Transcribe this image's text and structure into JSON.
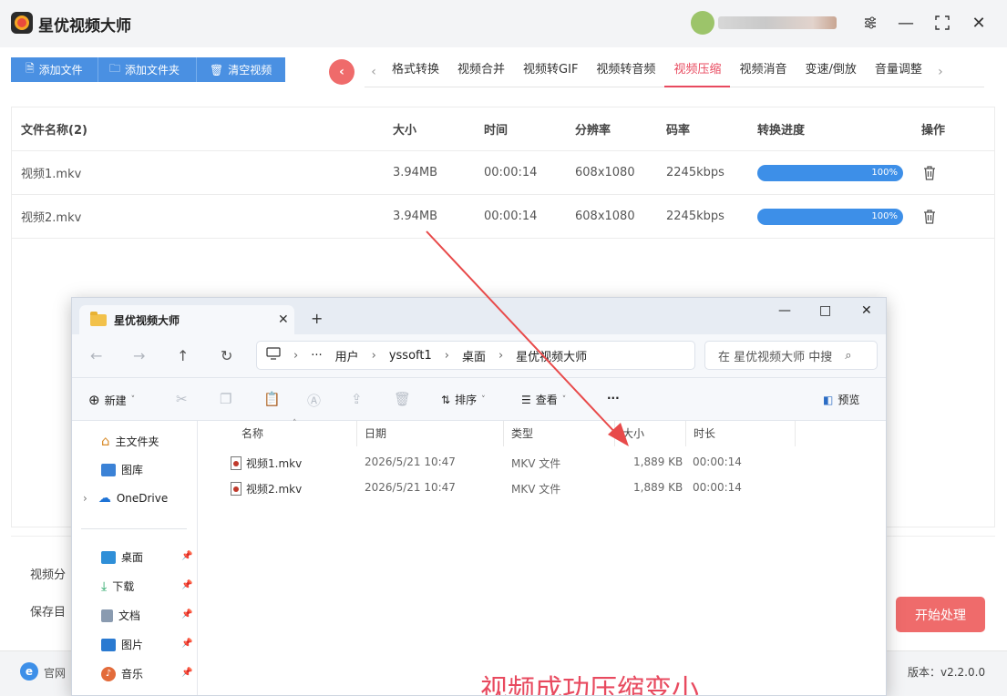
{
  "app": {
    "title": "星优视频大师"
  },
  "window": {
    "settings_icon": "sliders-icon",
    "minimize": "—",
    "maximize": "□",
    "close": "✕"
  },
  "toolbar": {
    "add_file": "添加文件",
    "add_folder": "添加文件夹",
    "clear_video": "清空视频"
  },
  "tabs": {
    "back": "‹",
    "items": [
      "格式转换",
      "视频合并",
      "视频转GIF",
      "视频转音频",
      "视频压缩",
      "视频消音",
      "变速/倒放",
      "音量调整"
    ],
    "active": "视频压缩",
    "left_arrow": "‹",
    "right_arrow": "›"
  },
  "table": {
    "headers": [
      "文件名称(2)",
      "大小",
      "时间",
      "分辨率",
      "码率",
      "转换进度",
      "操作"
    ],
    "rows": [
      {
        "name": "视频1.mkv",
        "size": "3.94MB",
        "time": "00:00:14",
        "resolution": "608x1080",
        "bitrate": "2245kbps",
        "progress": "100%"
      },
      {
        "name": "视频2.mkv",
        "size": "3.94MB",
        "time": "00:00:14",
        "resolution": "608x1080",
        "bitrate": "2245kbps",
        "progress": "100%"
      }
    ]
  },
  "bottom": {
    "label_split": "视频分",
    "label_save": "保存目",
    "start_button": "开始处理"
  },
  "footer": {
    "site": "官网",
    "version": "版本：v2.2.0.0"
  },
  "explorer": {
    "tab_title": "星优视频大师",
    "tab_close": "✕",
    "new_tab": "+",
    "minimize": "—",
    "maximize": "□",
    "close": "✕",
    "breadcrumb": [
      "用户",
      "yssoft1",
      "桌面",
      "星优视频大师"
    ],
    "breadcrumb_more": "···",
    "search_placeholder": "在 星优视频大师 中搜",
    "commands": {
      "new": "新建",
      "sort": "排序",
      "view": "查看",
      "more": "···",
      "preview": "预览"
    },
    "sidebar": [
      {
        "label": "主文件夹",
        "icon": "home-icon"
      },
      {
        "label": "图库",
        "icon": "gallery-icon"
      },
      {
        "label": "OneDrive",
        "icon": "cloud-icon"
      },
      {
        "label": "桌面",
        "icon": "desktop-icon",
        "pinned": true
      },
      {
        "label": "下载",
        "icon": "download-icon",
        "pinned": true
      },
      {
        "label": "文档",
        "icon": "document-icon",
        "pinned": true
      },
      {
        "label": "图片",
        "icon": "picture-icon",
        "pinned": true
      },
      {
        "label": "音乐",
        "icon": "music-icon",
        "pinned": true
      }
    ],
    "columns": [
      "名称",
      "日期",
      "类型",
      "大小",
      "时长"
    ],
    "files": [
      {
        "name": "视频1.mkv",
        "date": "2026/5/21 10:47",
        "type": "MKV 文件",
        "size": "1,889 KB",
        "duration": "00:00:14"
      },
      {
        "name": "视频2.mkv",
        "date": "2026/5/21 10:47",
        "type": "MKV 文件",
        "size": "1,889 KB",
        "duration": "00:00:14"
      }
    ]
  },
  "annotation": "视频成功压缩变小",
  "colors": {
    "accent": "#4a90e2",
    "active_tab": "#e84a5f",
    "start_button": "#ef6b6b",
    "annotation": "#e84a5f"
  }
}
